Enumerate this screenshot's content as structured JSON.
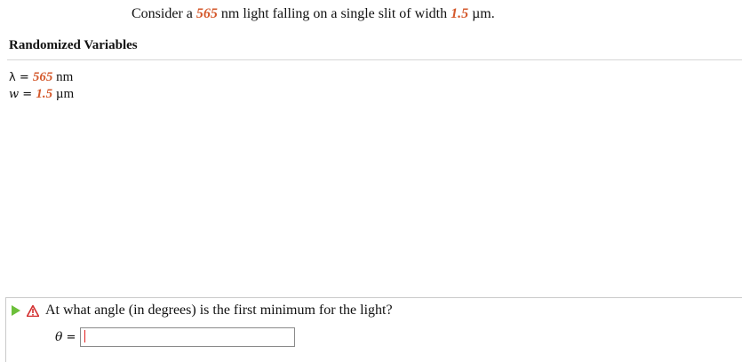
{
  "problem": {
    "text_before": "Consider a ",
    "wavelength_value": "565",
    "text_middle": " nm light falling on a single slit of width ",
    "width_value": "1.5",
    "text_after": " µm."
  },
  "variables": {
    "title": "Randomized Variables",
    "items": [
      {
        "symbol": "λ",
        "equals": " = ",
        "value": "565",
        "unit": " nm"
      },
      {
        "symbol": "w",
        "equals": " = ",
        "value": "1.5",
        "unit": " µm"
      }
    ]
  },
  "question": {
    "text": "At what angle (in degrees) is the first minimum for the light?",
    "answer_label": "θ",
    "answer_equals": "=",
    "answer_value": "",
    "icons": [
      "play-icon",
      "warning-icon"
    ],
    "play_color": "#6cbf3a",
    "warning_color": "#d32f2f"
  },
  "colors": {
    "variable_accent": "#d4592c"
  }
}
